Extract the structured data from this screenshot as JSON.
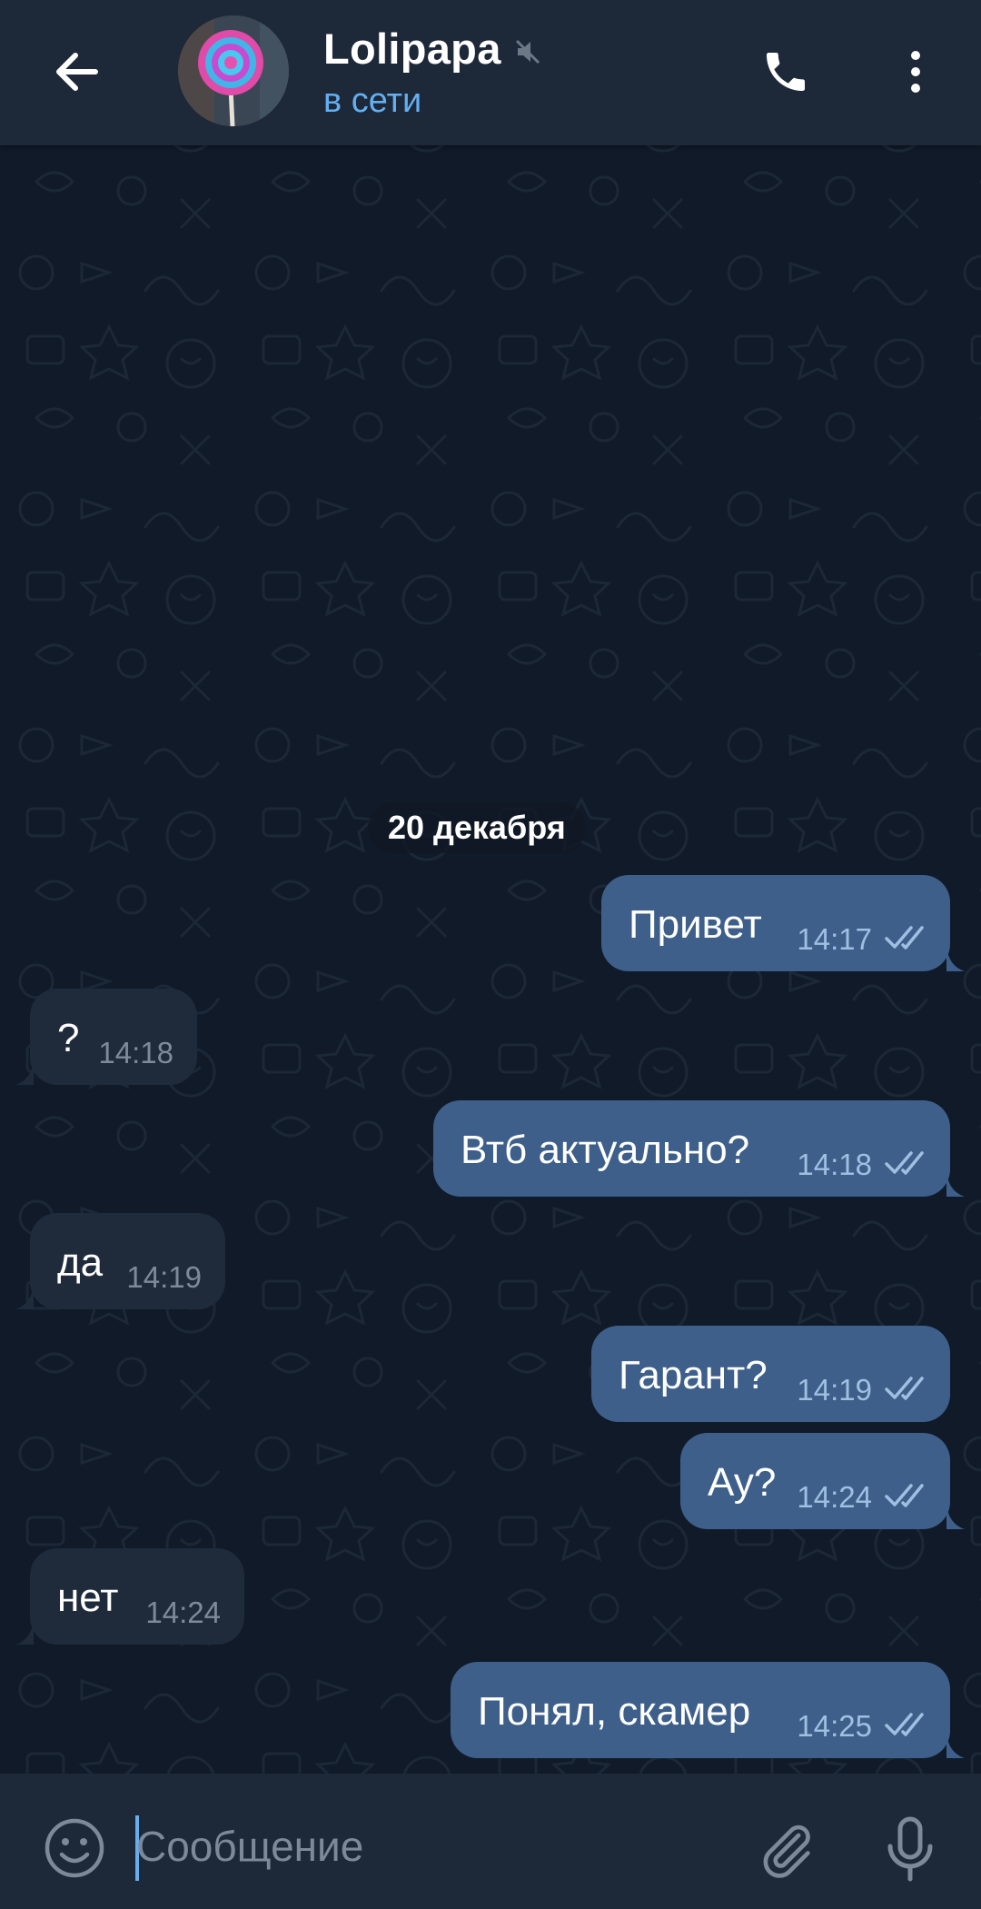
{
  "header": {
    "title": "Lolipapa",
    "status": "в сети",
    "muted": true
  },
  "date_separator": "20 декабря",
  "messages": [
    {
      "direction": "out",
      "text": "Привет",
      "time": "14:17",
      "read": true
    },
    {
      "direction": "in",
      "text": "?",
      "time": "14:18"
    },
    {
      "direction": "out",
      "text": "Втб актуально?",
      "time": "14:18",
      "read": true
    },
    {
      "direction": "in",
      "text": "да",
      "time": "14:19"
    },
    {
      "direction": "out",
      "text": "Гарант?",
      "time": "14:19",
      "read": true
    },
    {
      "direction": "out",
      "text": "Ау?",
      "time": "14:24",
      "read": true
    },
    {
      "direction": "in",
      "text": "нет",
      "time": "14:24"
    },
    {
      "direction": "out",
      "text": "Понял, скамер",
      "time": "14:25",
      "read": true
    }
  ],
  "composer": {
    "placeholder": "Сообщение"
  },
  "icons": {
    "back": "arrow-left-icon",
    "mute": "muted-speaker-icon",
    "call": "phone-icon",
    "menu": "more-vertical-icon",
    "emoji": "emoji-icon",
    "attach": "paperclip-icon",
    "mic": "microphone-icon",
    "read": "double-check-icon"
  },
  "colors": {
    "header_bg": "#1d2838",
    "chat_bg": "#101a28",
    "outgoing_bubble": "#3d5f8a",
    "incoming_bubble": "#1f2b3b",
    "accent": "#65aef0"
  }
}
